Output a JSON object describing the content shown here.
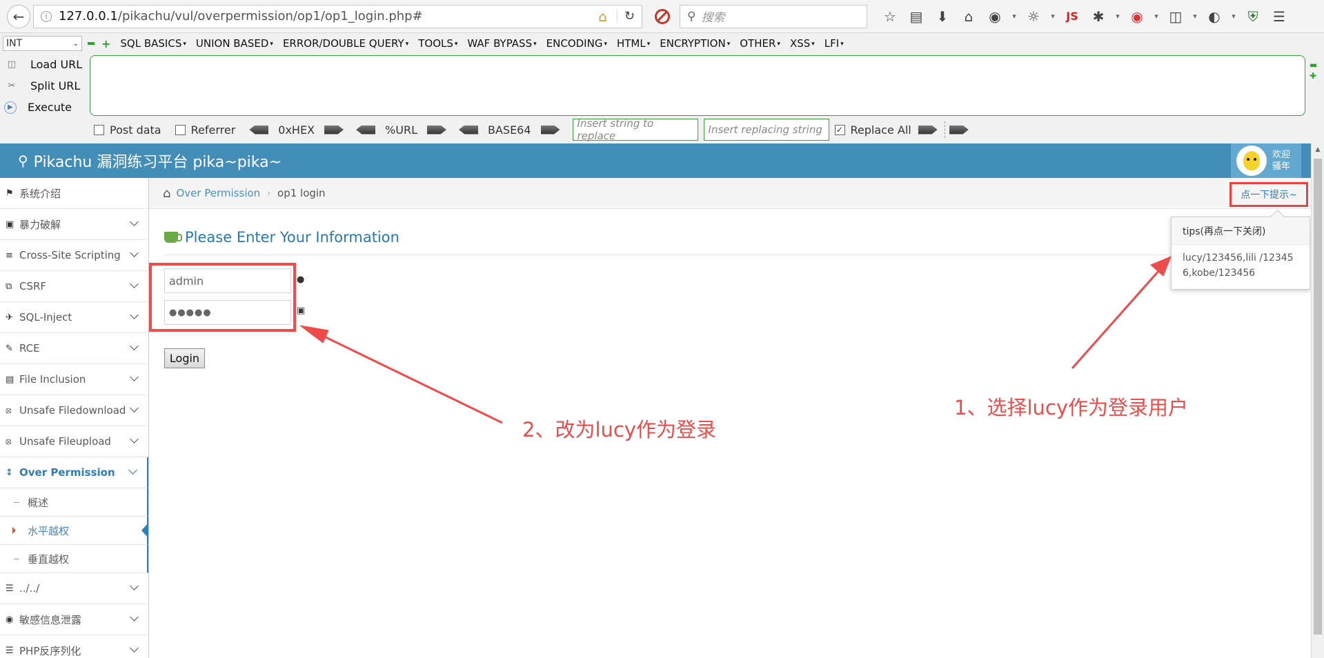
{
  "browser": {
    "url_host": "127.0.0.1",
    "url_path": "/pikachu/vul/overpermission/op1/op1_login.php#",
    "search_placeholder": "搜索",
    "js_label": "JS"
  },
  "hackbar": {
    "select_value": "INT",
    "menus": [
      "SQL BASICS",
      "UNION BASED",
      "ERROR/DOUBLE QUERY",
      "TOOLS",
      "WAF BYPASS",
      "ENCODING",
      "HTML",
      "ENCRYPTION",
      "OTHER",
      "XSS",
      "LFI"
    ],
    "load_url": "Load URL",
    "split_url": "Split URL",
    "execute": "Execute",
    "post_data": "Post data",
    "referrer": "Referrer",
    "hex": "0xHEX",
    "url_enc": "%URL",
    "base64": "BASE64",
    "replace_placeholder": "Insert string to replace",
    "replacing_placeholder": "Insert replacing string",
    "replace_all": "Replace All"
  },
  "header": {
    "brand": "Pikachu 漏洞练习平台 pika~pika~",
    "user_line1": "欢迎",
    "user_line2": "骚年"
  },
  "sidebar": {
    "items": [
      {
        "label": "系统介绍",
        "icon": "tag-icon"
      },
      {
        "label": "暴力破解",
        "icon": "lock-icon"
      },
      {
        "label": "Cross-Site Scripting",
        "icon": "sliders-icon"
      },
      {
        "label": "CSRF",
        "icon": "share-icon"
      },
      {
        "label": "SQL-Inject",
        "icon": "plane-icon"
      },
      {
        "label": "RCE",
        "icon": "pencil-icon"
      },
      {
        "label": "File Inclusion",
        "icon": "file-icon"
      },
      {
        "label": "Unsafe Filedownload",
        "icon": "download-icon"
      },
      {
        "label": "Unsafe Fileupload",
        "icon": "upload-icon"
      },
      {
        "label": "Over Permission",
        "icon": "text-height-icon"
      }
    ],
    "sub_items": [
      "概述",
      "水平越权",
      "垂直越权"
    ],
    "items_after": [
      {
        "label": "../../",
        "icon": "list-icon"
      },
      {
        "label": "敏感信息泄露",
        "icon": "camera-icon"
      },
      {
        "label": "PHP反序列化",
        "icon": "list-icon"
      }
    ]
  },
  "breadcrumb": {
    "parent": "Over Permission",
    "current": "op1 login"
  },
  "hint_button": "点一下提示~",
  "page_title": "Please Enter Your Information",
  "form": {
    "username_value": "admin",
    "password_value": "●●●●●",
    "login_label": "Login"
  },
  "tips": {
    "title": "tips(再点一下关闭)",
    "body": "lucy/123456,lili /123456,kobe/123456"
  },
  "annotations": {
    "note1": "1、选择lucy作为登录用户",
    "note2": "2、改为lucy作为登录"
  },
  "colors": {
    "header_blue": "#438eb9",
    "annotation_red": "#ef4b4b",
    "link_blue": "#2b7dbc"
  }
}
